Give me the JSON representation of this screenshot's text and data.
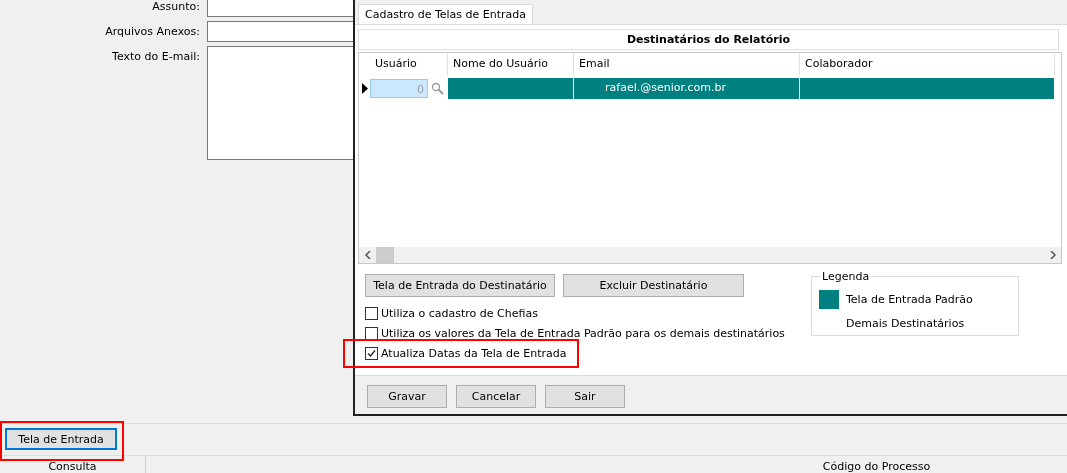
{
  "background_form": {
    "fields": [
      {
        "label": "Assunto:",
        "kind": "line"
      },
      {
        "label": "Arquivos Anexos:",
        "kind": "line"
      },
      {
        "label": "Texto do E-mail:",
        "kind": "area"
      }
    ],
    "button": "Tela de Entrada",
    "status_bar": [
      "Consulta",
      "Código do Processo"
    ]
  },
  "dialog": {
    "tabs": [
      {
        "label": "Cadastro de Telas de Entrada",
        "selected": true
      }
    ],
    "group_title": "Destinatários do Relatório",
    "table": {
      "columns": [
        "Usuário",
        "Nome do Usuário",
        "Email",
        "Colaborador"
      ],
      "rows": [
        {
          "selected": true,
          "cells": [
            "0",
            "",
            "rafael.@senior.com.br",
            ""
          ]
        }
      ]
    },
    "buttons": [
      "Tela de Entrada do Destinatário",
      "Excluir Destinatário"
    ],
    "checkboxes": [
      {
        "label": "Utiliza o cadastro de Chefias",
        "checked": false
      },
      {
        "label": "Utiliza os valores da Tela de Entrada Padrão para os demais destinatários",
        "checked": false
      },
      {
        "label": "Atualiza Datas da Tela de Entrada",
        "checked": true
      }
    ],
    "legend": {
      "title": "Legenda",
      "items": [
        {
          "label": "Tela de Entrada Padrão",
          "color": "#008080"
        },
        {
          "label": "Demais Destinatários"
        }
      ]
    },
    "footer_buttons": [
      "Gravar",
      "Cancelar",
      "Sair"
    ]
  }
}
